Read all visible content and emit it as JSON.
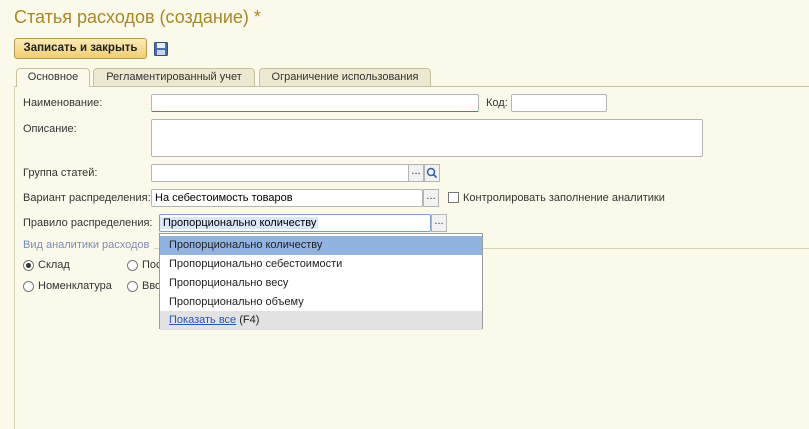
{
  "title": "Статья расходов (создание) *",
  "toolbar": {
    "save_close": "Записать и закрыть",
    "save_icon": "save-disk-icon"
  },
  "tabs": [
    "Основное",
    "Регламентированный учет",
    "Ограничение использования"
  ],
  "form": {
    "name_label": "Наименование:",
    "code_label": "Код:",
    "description_label": "Описание:",
    "group_label": "Группа статей:",
    "variant_label": "Вариант распределения:",
    "variant_value": "На себестоимость товаров",
    "control_label": "Контролировать заполнение аналитики",
    "rule_label": "Правило распределения:",
    "rule_value": "Пропорционально количеству",
    "analytics_group": "Вид аналитики расходов",
    "radios": [
      "Склад",
      "Пос",
      "Номенклатура",
      "Вво"
    ]
  },
  "dropdown": {
    "options": [
      "Пропорционально количеству",
      "Пропорционально себестоимости",
      "Пропорционально весу",
      "Пропорционально объему"
    ],
    "show_all_link": "Показать все",
    "show_all_key": "(F4)"
  }
}
